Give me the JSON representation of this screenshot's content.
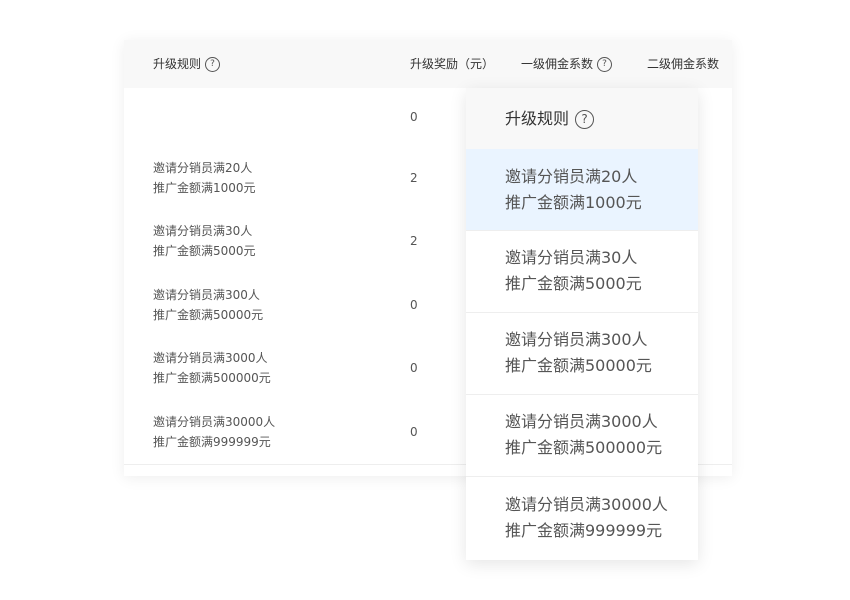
{
  "table": {
    "headers": {
      "rule": "升级规则",
      "reward": "升级奖励（元）",
      "commission1": "一级佣金系数",
      "commission2": "二级佣金系数"
    },
    "help_glyph": "?",
    "rows": [
      {
        "rule_line1": "",
        "rule_line2": "",
        "reward": "0"
      },
      {
        "rule_line1": "邀请分销员满20人",
        "rule_line2": "推广金额满1000元",
        "reward": "2"
      },
      {
        "rule_line1": "邀请分销员满30人",
        "rule_line2": "推广金额满5000元",
        "reward": "2"
      },
      {
        "rule_line1": "邀请分销员满300人",
        "rule_line2": "推广金额满50000元",
        "reward": "0"
      },
      {
        "rule_line1": "邀请分销员满3000人",
        "rule_line2": "推广金额满500000元",
        "reward": "0"
      },
      {
        "rule_line1": "邀请分销员满30000人",
        "rule_line2": "推广金额满999999元",
        "reward": "0"
      }
    ]
  },
  "popup": {
    "header": "升级规则",
    "help_glyph": "?",
    "items": [
      {
        "line1": "邀请分销员满20人",
        "line2": "推广金额满1000元"
      },
      {
        "line1": "邀请分销员满30人",
        "line2": "推广金额满5000元"
      },
      {
        "line1": "邀请分销员满300人",
        "line2": "推广金额满50000元"
      },
      {
        "line1": "邀请分销员满3000人",
        "line2": "推广金额满500000元"
      },
      {
        "line1": "邀请分销员满30000人",
        "line2": "推广金额满999999元"
      }
    ],
    "highlighted_index": 0
  },
  "colors": {
    "highlight": "#eaf4ff",
    "header_bg": "#f8f8f8",
    "divider": "#eeeeee"
  }
}
